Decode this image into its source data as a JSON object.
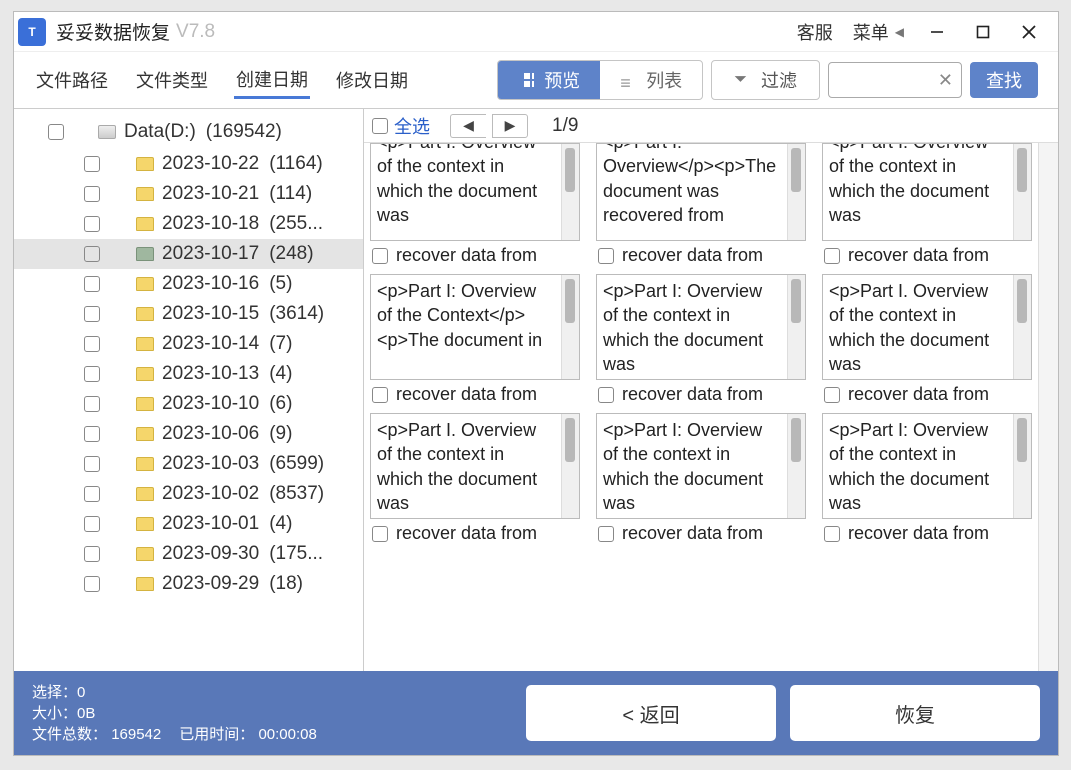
{
  "appIcon": "T",
  "title": "妥妥数据恢复",
  "version": "V7.8",
  "titlebar": {
    "support": "客服",
    "menu": "菜单"
  },
  "tabs": {
    "path": "文件路径",
    "type": "文件类型",
    "created": "创建日期",
    "modified": "修改日期"
  },
  "toolbar": {
    "preview": "预览",
    "list": "列表",
    "filter": "过滤",
    "find": "查找"
  },
  "tree": {
    "root": {
      "label": "Data(D:)",
      "count": "(169542)"
    },
    "items": [
      {
        "label": "2023-10-22",
        "count": "(1164)"
      },
      {
        "label": "2023-10-21",
        "count": "(114)"
      },
      {
        "label": "2023-10-18",
        "count": "(255..."
      },
      {
        "label": "2023-10-17",
        "count": "(248)",
        "selected": true
      },
      {
        "label": "2023-10-16",
        "count": "(5)"
      },
      {
        "label": "2023-10-15",
        "count": "(3614)"
      },
      {
        "label": "2023-10-14",
        "count": "(7)"
      },
      {
        "label": "2023-10-13",
        "count": "(4)"
      },
      {
        "label": "2023-10-10",
        "count": "(6)"
      },
      {
        "label": "2023-10-06",
        "count": "(9)"
      },
      {
        "label": "2023-10-03",
        "count": "(6599)"
      },
      {
        "label": "2023-10-02",
        "count": "(8537)"
      },
      {
        "label": "2023-10-01",
        "count": "(4)"
      },
      {
        "label": "2023-09-30",
        "count": "(175..."
      },
      {
        "label": "2023-09-29",
        "count": "(18)"
      }
    ]
  },
  "mainHeader": {
    "selectAll": "全选",
    "page": "1/9"
  },
  "cards": [
    [
      {
        "text": "<p>Part I: Overview of the context in which the document was",
        "label": "recover data from"
      },
      {
        "text": "<p>Part I: Overview</p><p>The document was recovered from",
        "label": "recover data from"
      },
      {
        "text": "<p>Part I: Overview of the context in which the document was",
        "label": "recover data from"
      }
    ],
    [
      {
        "text": "<p>Part I: Overview of the Context</p><p>The document in",
        "label": "recover data from"
      },
      {
        "text": "<p>Part I: Overview of the context in which the document was",
        "label": "recover data from"
      },
      {
        "text": "<p>Part I. Overview of the context in which the document was",
        "label": "recover data from"
      }
    ],
    [
      {
        "text": "<p>Part I. Overview of the context in which the document was",
        "label": "recover data from"
      },
      {
        "text": "<p>Part I: Overview of the context in which the document was",
        "label": "recover data from"
      },
      {
        "text": "<p>Part I: Overview of the context in which the document was",
        "label": "recover data from"
      }
    ]
  ],
  "footer": {
    "selectLabel": "选择：",
    "selectVal": "0",
    "sizeLabel": "大小：",
    "sizeVal": "0B",
    "totalLabel": "文件总数：",
    "totalVal": "169542",
    "elapsedLabel": "已用时间：",
    "elapsedVal": "00:00:08",
    "back": "< 返回",
    "recover": "恢复"
  }
}
